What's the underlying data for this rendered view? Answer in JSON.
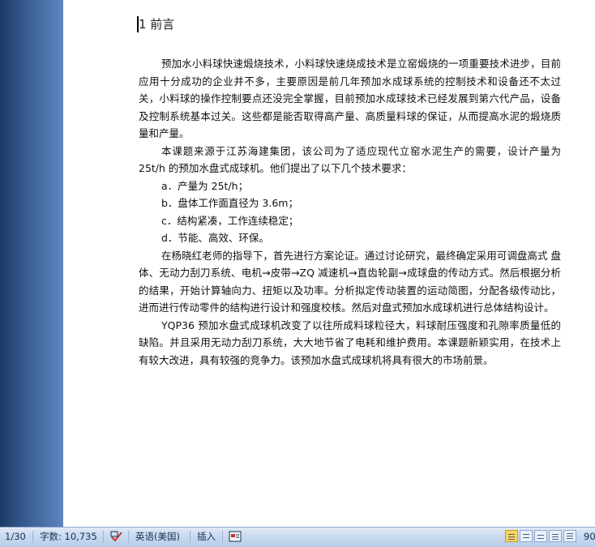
{
  "document": {
    "heading": "1 前言",
    "paragraphs": [
      "预加水小料球快速煅烧技术，小料球快速烧成技术是立窑煅烧的一项重要技术进步，目前应用十分成功的企业并不多，主要原因是前几年预加水成球系统的控制技术和设备还不太过关，小料球的操作控制要点还没完全掌握，目前预加水成球技术已经发展到第六代产品，设备及控制系统基本过关。这些都是能否取得高产量、高质量料球的保证，从而提高水泥的煅烧质量和产量。",
      "本课题来源于江苏海建集团，该公司为了适应现代立窑水泥生产的需要，设计产量为 25t/h 的预加水盘式成球机。他们提出了以下几个技术要求："
    ],
    "list": [
      "a．产量为 25t/h；",
      "b．盘体工作面直径为 3.6m；",
      "c．结构紧凑，工作连续稳定；",
      "d．节能、高效、环保。"
    ],
    "paragraphs2": [
      "在杨晓红老师的指导下，首先进行方案论证。通过讨论研究，最终确定采用可调盘高式 盘体、无动力刮刀系统、电机→皮带→ZQ 减速机→直齿轮副→成球盘的传动方式。然后根据分析的结果，开始计算轴向力、扭矩以及功率。分析拟定传动装置的运动简图，分配各级传动比，进而进行传动零件的结构进行设计和强度校核。然后对盘式预加水成球机进行总体结构设计。",
      "YQP36 预加水盘式成球机改变了以往所成料球粒径大，料球耐压强度和孔隙率质量低的缺陷。并且采用无动力刮刀系统，大大地节省了电耗和维护费用。本课题新颖实用，在技术上有较大改进，具有较强的竞争力。该预加水盘式成球机将具有很大的市场前景。"
    ]
  },
  "statusbar": {
    "page": "1/30",
    "word_count": "字数: 10,735",
    "language": "英语(美国)",
    "mode": "插入",
    "zoom": "90"
  },
  "colors": {
    "statusbar_bg": "#c7d8ee",
    "left_panel": "#3a5e95"
  }
}
